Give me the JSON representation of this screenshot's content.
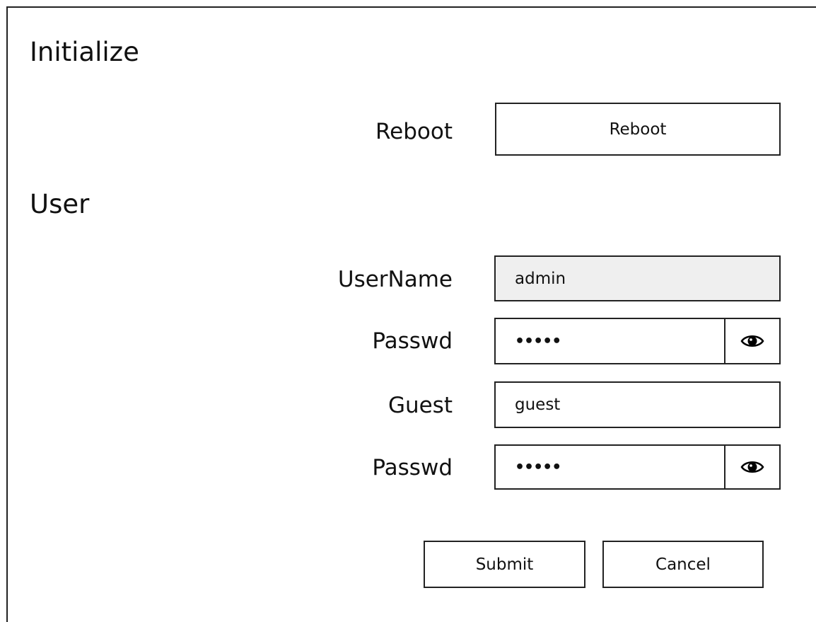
{
  "sections": {
    "initialize": "Initialize",
    "user": "User"
  },
  "reboot": {
    "label": "Reboot",
    "button": "Reboot"
  },
  "user": {
    "username_label": "UserName",
    "username_value": "admin",
    "admin_passwd_label": "Passwd",
    "admin_passwd_value": "•••••",
    "guest_label": "Guest",
    "guest_value": "guest",
    "guest_passwd_label": "Passwd",
    "guest_passwd_value": "•••••",
    "toggle_icon": "eye-icon"
  },
  "actions": {
    "submit": "Submit",
    "cancel": "Cancel"
  }
}
